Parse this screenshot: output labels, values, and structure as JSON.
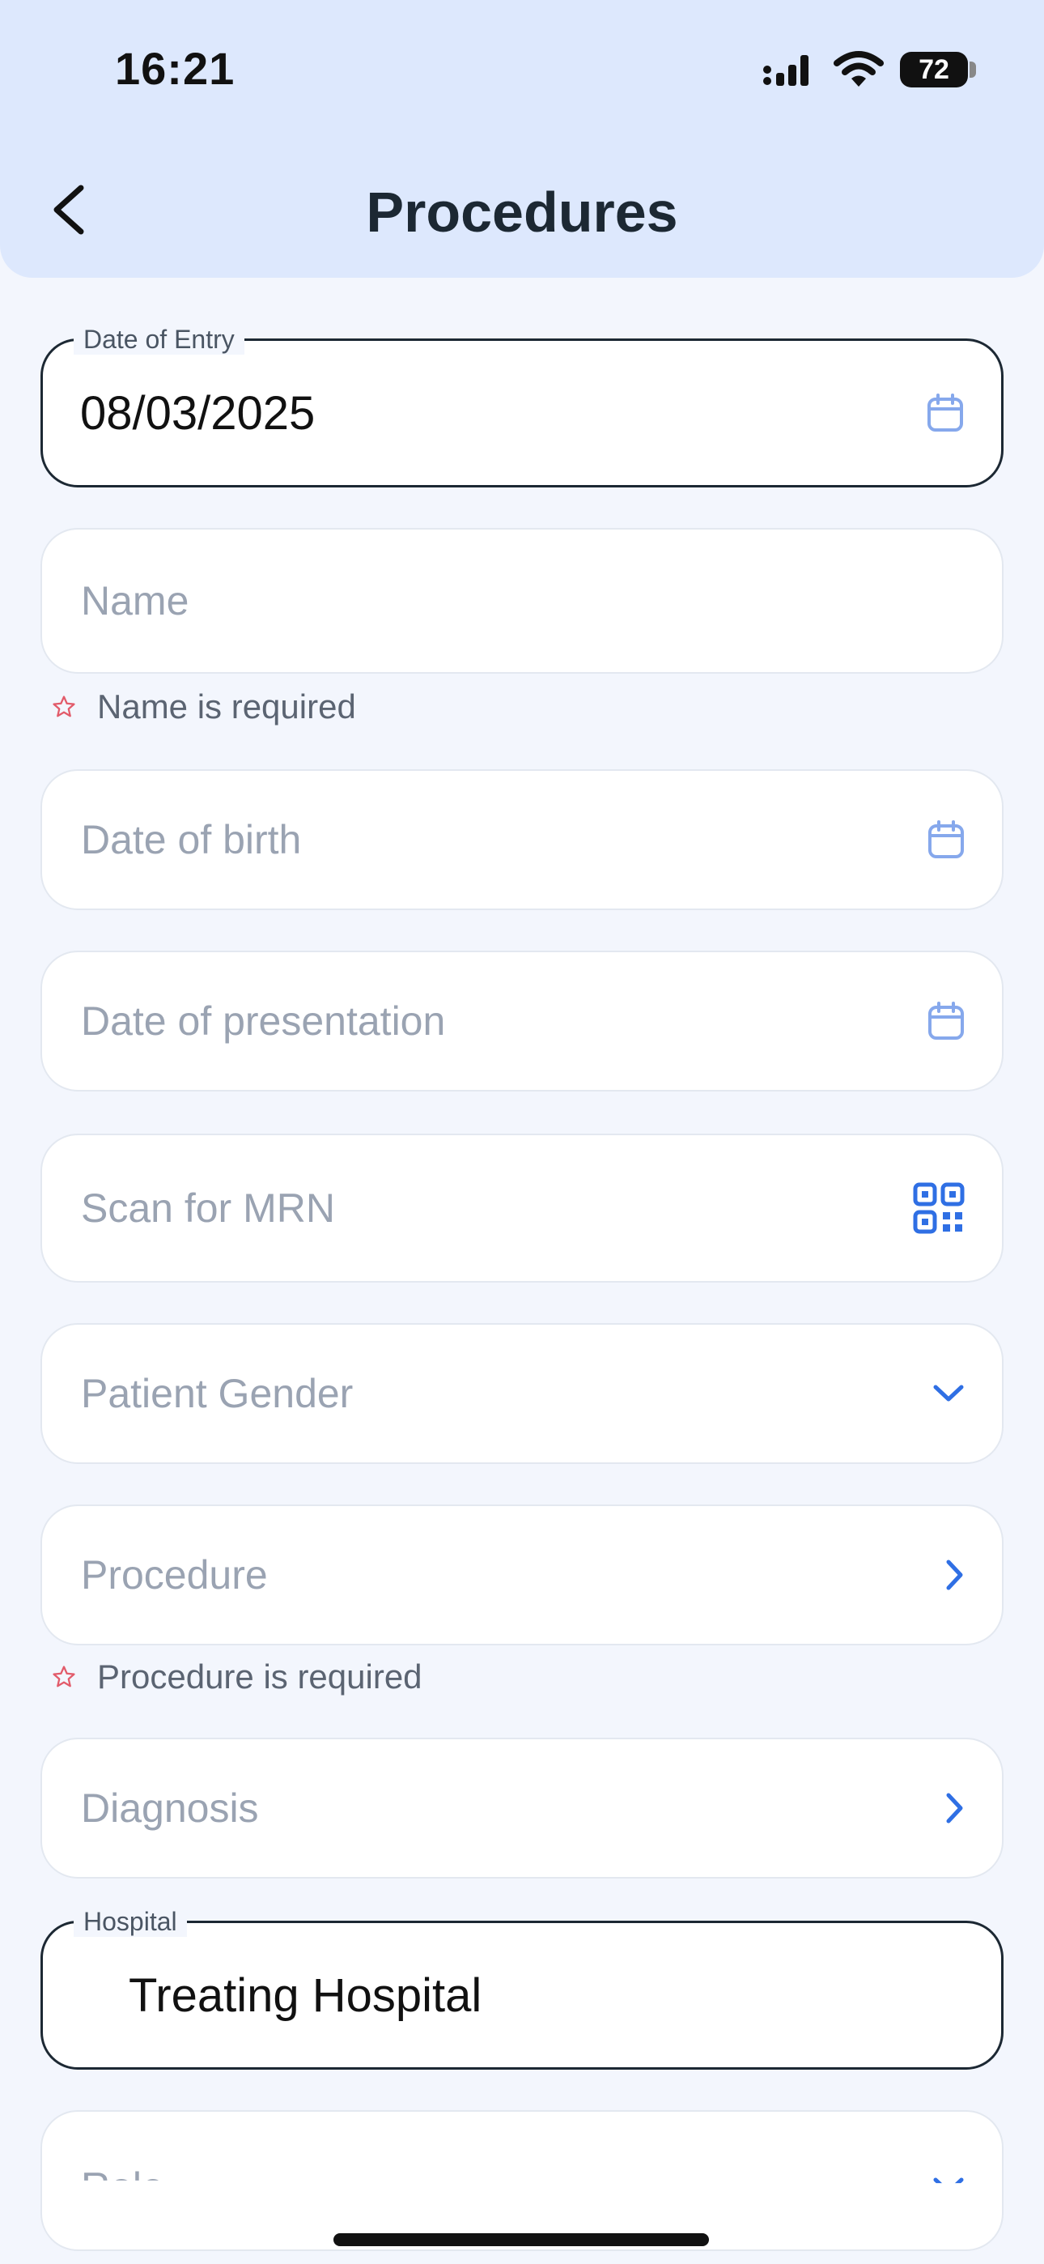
{
  "status_bar": {
    "time": "16:21",
    "battery": "72"
  },
  "header": {
    "title": "Procedures"
  },
  "form": {
    "date_of_entry": {
      "label": "Date of Entry",
      "value": "08/03/2025"
    },
    "name": {
      "placeholder": "Name",
      "error": "Name is required"
    },
    "date_of_birth": {
      "placeholder": "Date of birth"
    },
    "date_of_presentation": {
      "placeholder": "Date of presentation"
    },
    "mrn": {
      "placeholder": "Scan for MRN"
    },
    "gender": {
      "placeholder": "Patient Gender"
    },
    "procedure": {
      "placeholder": "Procedure",
      "error": "Procedure is required"
    },
    "diagnosis": {
      "placeholder": "Diagnosis"
    },
    "hospital": {
      "label": "Hospital",
      "value": "Treating Hospital"
    },
    "role": {
      "placeholder": "Role"
    }
  },
  "colors": {
    "accent": "#2f6fe4",
    "icon_light": "#86a8ec",
    "error_star": "#e25b6a"
  }
}
